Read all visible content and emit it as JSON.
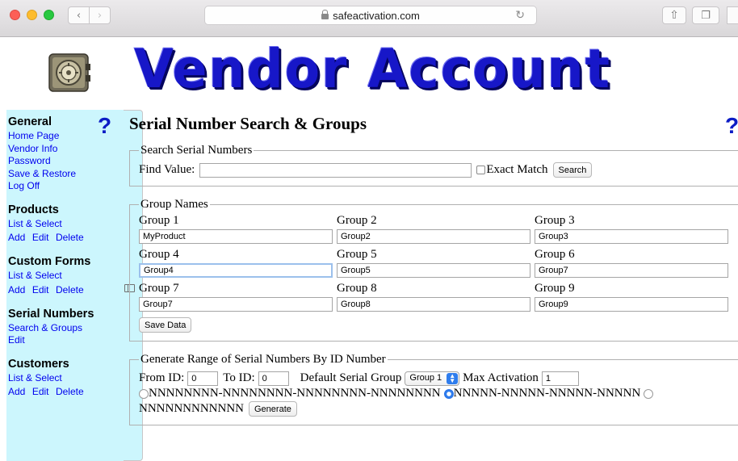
{
  "browser": {
    "url": "safeactivation.com",
    "nav_back": "‹",
    "nav_forward": "›",
    "reload": "↻",
    "share": "⇧",
    "tabs": "❐"
  },
  "banner": {
    "title": "Vendor Account",
    "logo_icon": "vault-safe-icon",
    "title_color": "#1717c8"
  },
  "sidebar": {
    "help_glyph": "?",
    "sections": [
      {
        "heading": "General",
        "links": [
          "Home Page",
          "Vendor Info",
          "Password",
          "Save & Restore",
          "Log Off"
        ]
      },
      {
        "heading": "Products",
        "links": [
          "List & Select",
          "Add",
          "Edit",
          "Delete"
        ]
      },
      {
        "heading": "Custom Forms",
        "links": [
          "List & Select",
          "Add",
          "Edit",
          "Delete"
        ]
      },
      {
        "heading": "Serial Numbers",
        "links": [
          "Search & Groups",
          "Edit"
        ]
      },
      {
        "heading": "Customers",
        "links": [
          "List & Select",
          "Add",
          "Edit",
          "Delete"
        ]
      }
    ],
    "background": "#ccf6fd",
    "link_color": "#0000ee"
  },
  "main": {
    "title": "Serial Number Search & Groups",
    "help_glyph": "?",
    "search": {
      "legend": "Search Serial Numbers",
      "find_label": "Find Value:",
      "find_value": "",
      "exact_label": "Exact Match",
      "exact_checked": false,
      "search_button": "Search"
    },
    "groups": {
      "legend": "Group Names",
      "items": [
        {
          "label": "Group 1",
          "value": "MyProduct"
        },
        {
          "label": "Group 2",
          "value": "Group2"
        },
        {
          "label": "Group 3",
          "value": "Group3"
        },
        {
          "label": "Group 4",
          "value": "Group4"
        },
        {
          "label": "Group 5",
          "value": "Group5"
        },
        {
          "label": "Group 6",
          "value": "Group7"
        },
        {
          "label": "Group 7",
          "value": "Group7"
        },
        {
          "label": "Group 8",
          "value": "Group8"
        },
        {
          "label": "Group 9",
          "value": "Group9"
        }
      ],
      "save_button": "Save Data"
    },
    "generate": {
      "legend": "Generate Range of Serial Numbers By ID Number",
      "from_label": "From ID:",
      "from_value": "0",
      "to_label": "To ID:",
      "to_value": "0",
      "default_group_label": "Default Serial Group",
      "default_group_selected": "Group 1",
      "max_label": "Max Activation",
      "max_value": "1",
      "format_1": "NNNNNNNN-NNNNNNNN-NNNNNNNN-NNNNNNNN",
      "format_2": "NNNNN-NNNNN-NNNNN-NNNNN",
      "format_3": "NNNNNNNNNNNN",
      "selected_format": 2,
      "generate_button": "Generate"
    }
  }
}
